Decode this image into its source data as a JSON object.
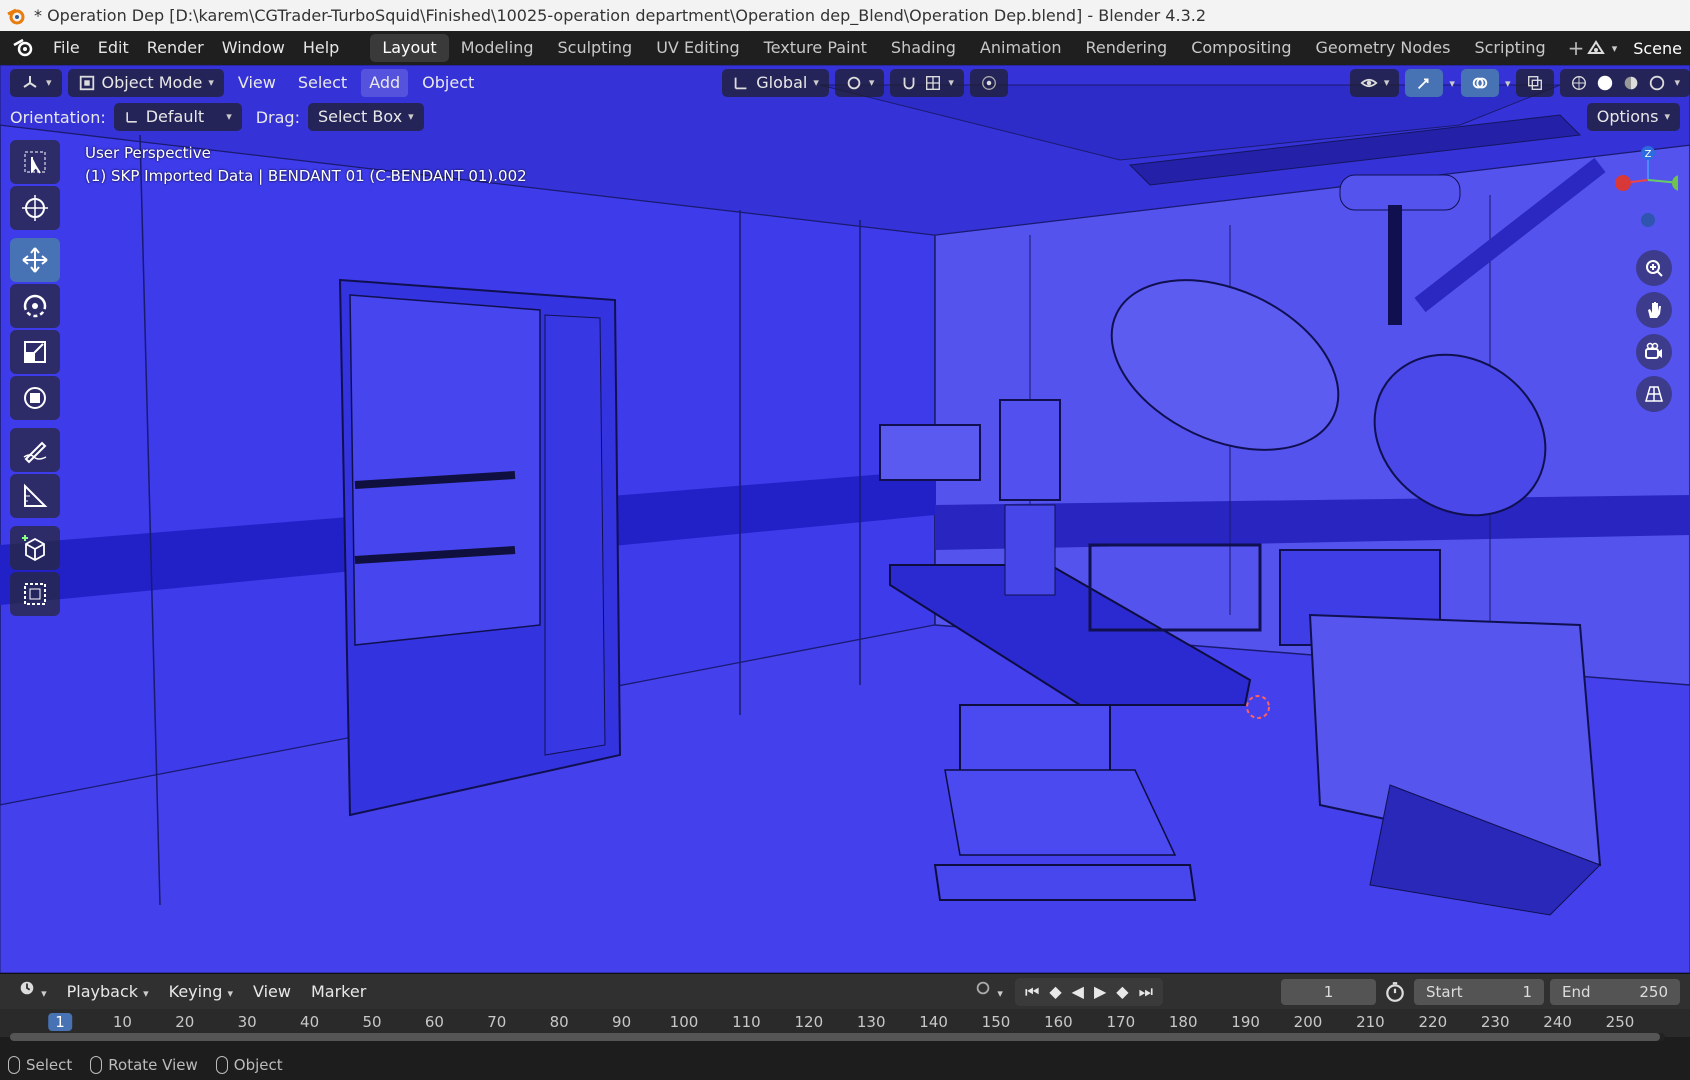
{
  "window": {
    "title": "* Operation Dep [D:\\karem\\CGTrader-TurboSquid\\Finished\\10025-operation department\\Operation dep_Blend\\Operation Dep.blend] - Blender 4.3.2"
  },
  "menu": [
    "File",
    "Edit",
    "Render",
    "Window",
    "Help"
  ],
  "workspaces": [
    "Layout",
    "Modeling",
    "Sculpting",
    "UV Editing",
    "Texture Paint",
    "Shading",
    "Animation",
    "Rendering",
    "Compositing",
    "Geometry Nodes",
    "Scripting"
  ],
  "active_workspace": "Layout",
  "scene_label": "Scene",
  "viewport_header": {
    "mode": "Object Mode",
    "menus": [
      "View",
      "Select",
      "Add",
      "Object"
    ],
    "transform_orientation": "Global",
    "options_label": "Options"
  },
  "tool_settings": {
    "orientation_label": "Orientation:",
    "orientation_value": "Default",
    "drag_label": "Drag:",
    "drag_value": "Select Box"
  },
  "viewport_overlay": {
    "view_name": "User Perspective",
    "object_info": "(1) SKP Imported Data | BENDANT 01 (C-BENDANT 01).002"
  },
  "timeline": {
    "menus": [
      "Playback",
      "Keying",
      "View",
      "Marker"
    ],
    "current_frame": "1",
    "start_label": "Start",
    "start_value": "1",
    "end_label": "End",
    "end_value": "250",
    "ticks": [
      "1",
      "10",
      "20",
      "30",
      "40",
      "50",
      "60",
      "70",
      "80",
      "90",
      "100",
      "110",
      "120",
      "130",
      "140",
      "150",
      "160",
      "170",
      "180",
      "190",
      "200",
      "210",
      "220",
      "230",
      "240",
      "250"
    ]
  },
  "statusbar": {
    "items": [
      "Select",
      "Rotate View",
      "Object"
    ]
  },
  "colors": {
    "viewport_bg": "#3a38e8",
    "accent": "#4772b3"
  }
}
